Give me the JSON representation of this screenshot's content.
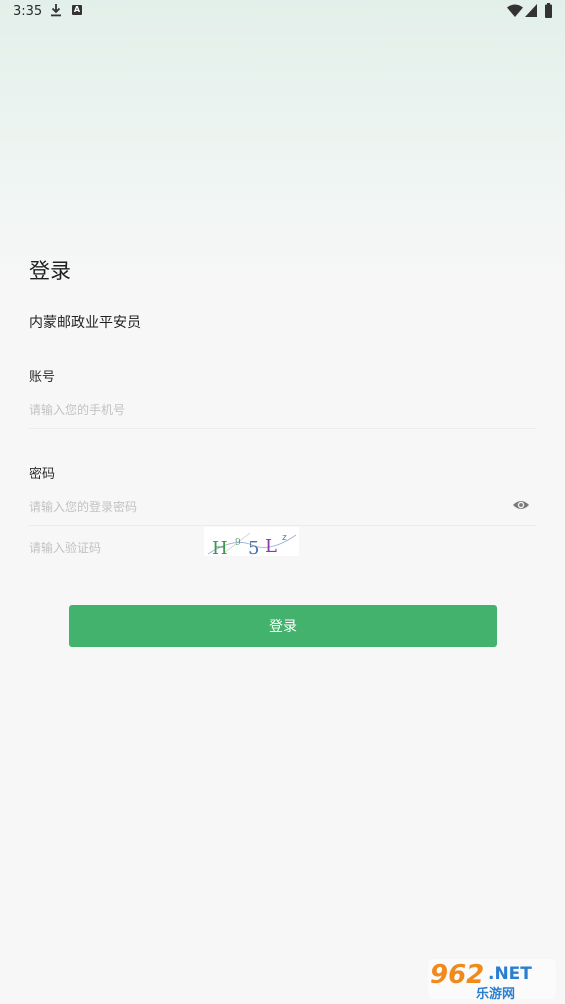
{
  "status_bar": {
    "time": "3:35",
    "icons": [
      "download-icon",
      "a-badge-icon",
      "wifi-icon",
      "signal-icon",
      "battery-icon"
    ]
  },
  "page": {
    "title": "登录",
    "org_name": "内蒙邮政业平安员"
  },
  "account": {
    "label": "账号",
    "placeholder": "请输入您的手机号",
    "value": ""
  },
  "password": {
    "label": "密码",
    "placeholder": "请输入您的登录密码",
    "value": "",
    "toggle_icon": "eye-icon"
  },
  "captcha": {
    "placeholder": "请输入验证码",
    "value": "",
    "image_text": "H95Lz"
  },
  "actions": {
    "login_label": "登录"
  },
  "watermark": {
    "text": "962.NET 乐游网"
  },
  "colors": {
    "accent": "#42b26c",
    "background": "#f7f7f7",
    "top_gradient": "#e3efea"
  }
}
